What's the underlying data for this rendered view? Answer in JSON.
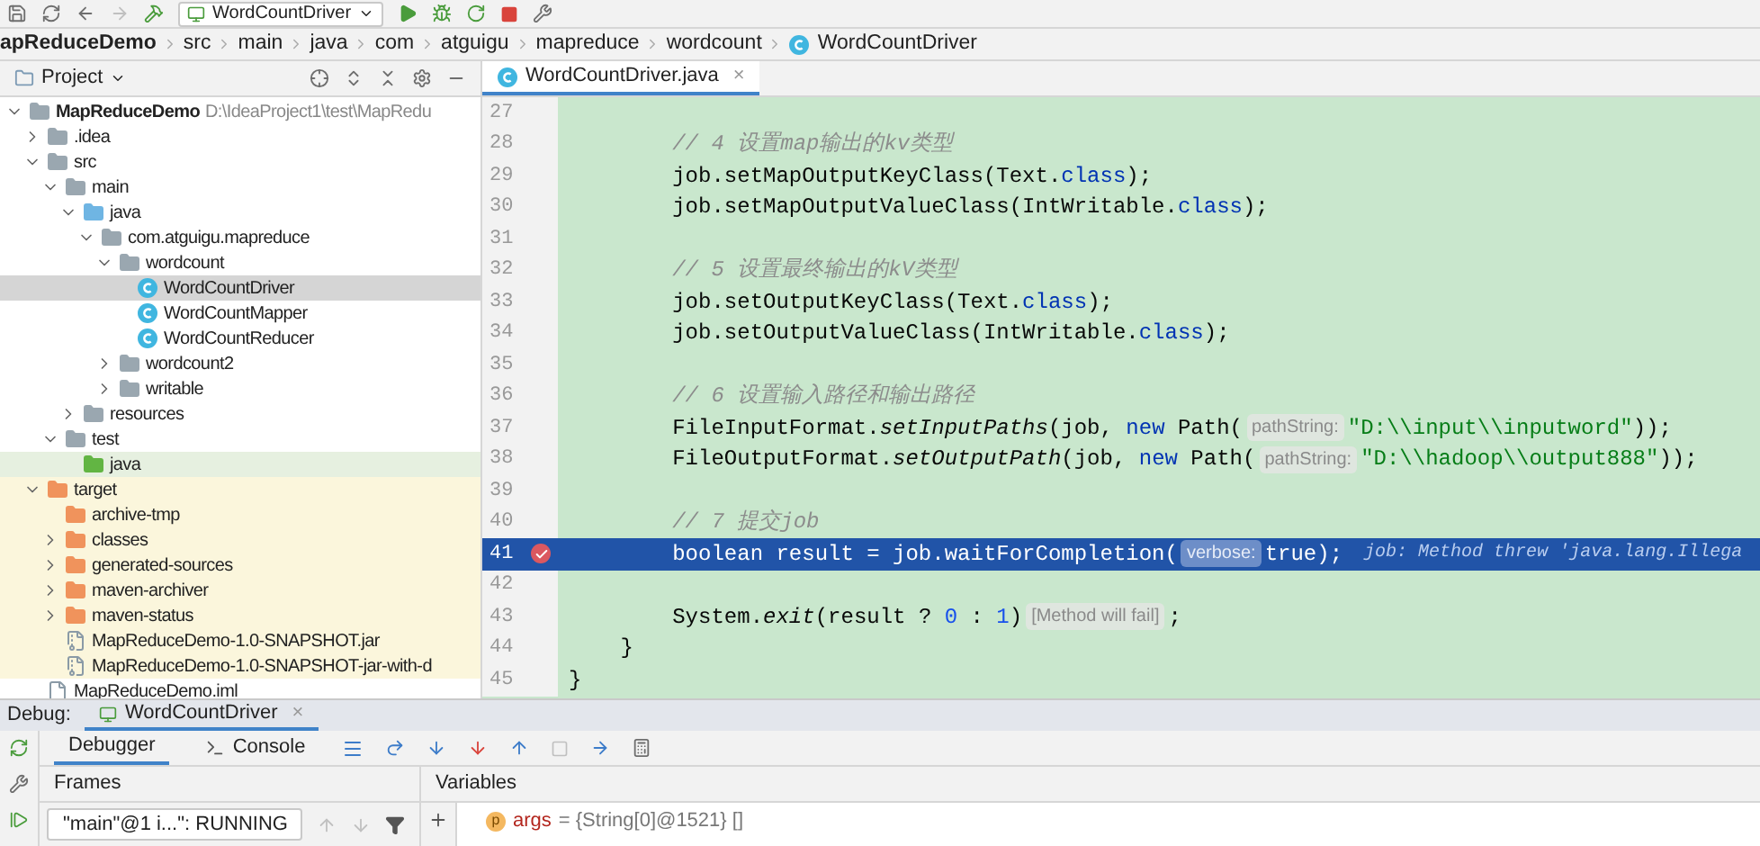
{
  "toolbar": {
    "run_config": "WordCountDriver"
  },
  "breadcrumbs": [
    {
      "label": "apReduceDemo",
      "kind": "module"
    },
    {
      "label": "src",
      "kind": "folder"
    },
    {
      "label": "main",
      "kind": "folder"
    },
    {
      "label": "java",
      "kind": "folder"
    },
    {
      "label": "com",
      "kind": "folder"
    },
    {
      "label": "atguigu",
      "kind": "folder"
    },
    {
      "label": "mapreduce",
      "kind": "folder"
    },
    {
      "label": "wordcount",
      "kind": "folder"
    },
    {
      "label": "WordCountDriver",
      "kind": "class"
    }
  ],
  "project": {
    "title": "Project",
    "tree": [
      {
        "label": "MapReduceDemo",
        "hint": "D:\\IdeaProject1\\test\\MapRedu",
        "kind": "module",
        "expanded": true,
        "selected": false,
        "children": [
          {
            "label": ".idea",
            "kind": "folder",
            "expanded": false,
            "selected": false
          },
          {
            "label": "src",
            "kind": "folder",
            "expanded": true,
            "selected": false,
            "children": [
              {
                "label": "main",
                "kind": "folder",
                "expanded": true,
                "selected": false,
                "children": [
                  {
                    "label": "java",
                    "kind": "source",
                    "expanded": true,
                    "selected": false,
                    "children": [
                      {
                        "label": "com.atguigu.mapreduce",
                        "kind": "package",
                        "expanded": true,
                        "selected": false,
                        "children": [
                          {
                            "label": "wordcount",
                            "kind": "package",
                            "expanded": true,
                            "selected": false,
                            "children": [
                              {
                                "label": "WordCountDriver",
                                "kind": "class",
                                "selected": true
                              },
                              {
                                "label": "WordCountMapper",
                                "kind": "class",
                                "selected": false
                              },
                              {
                                "label": "WordCountReducer",
                                "kind": "class",
                                "selected": false
                              }
                            ]
                          },
                          {
                            "label": "wordcount2",
                            "kind": "package",
                            "expanded": false,
                            "selected": false
                          },
                          {
                            "label": "writable",
                            "kind": "package",
                            "expanded": false,
                            "selected": false
                          }
                        ]
                      }
                    ]
                  },
                  {
                    "label": "resources",
                    "kind": "resources",
                    "expanded": false,
                    "selected": false
                  }
                ]
              },
              {
                "label": "test",
                "kind": "folder",
                "expanded": true,
                "selected": false,
                "children": [
                  {
                    "label": "java",
                    "kind": "test",
                    "selected": false
                  }
                ]
              }
            ]
          },
          {
            "label": "target",
            "kind": "excluded",
            "expanded": true,
            "selected": false,
            "children": [
              {
                "label": "archive-tmp",
                "kind": "excluded",
                "selected": false
              },
              {
                "label": "classes",
                "kind": "excluded",
                "expanded": false,
                "selected": false
              },
              {
                "label": "generated-sources",
                "kind": "excluded",
                "expanded": false,
                "selected": false
              },
              {
                "label": "maven-archiver",
                "kind": "excluded",
                "expanded": false,
                "selected": false
              },
              {
                "label": "maven-status",
                "kind": "excluded",
                "expanded": false,
                "selected": false
              },
              {
                "label": "MapReduceDemo-1.0-SNAPSHOT.jar",
                "kind": "jar",
                "selected": false
              },
              {
                "label": "MapReduceDemo-1.0-SNAPSHOT-jar-with-d",
                "kind": "jar",
                "selected": false
              }
            ]
          },
          {
            "label": "MapReduceDemo.iml",
            "kind": "file",
            "selected": false
          }
        ]
      }
    ]
  },
  "editor": {
    "tab": {
      "label": "WordCountDriver.java",
      "close": "×",
      "selected": true
    },
    "lines": [
      {
        "number": "27",
        "current": false,
        "breakpoint": false
      },
      {
        "number": "28",
        "current": false,
        "breakpoint": false,
        "tokens": [
          {
            "kind": "comment",
            "text": "        // 4 设置map输出的kv类型"
          }
        ]
      },
      {
        "number": "29",
        "current": false,
        "breakpoint": false,
        "tokens": [
          {
            "kind": "text",
            "text": "        job.setMapOutputKeyClass(Text."
          },
          {
            "kind": "keyword",
            "text": "class"
          },
          {
            "kind": "text",
            "text": ");"
          }
        ]
      },
      {
        "number": "30",
        "current": false,
        "breakpoint": false,
        "tokens": [
          {
            "kind": "text",
            "text": "        job.setMapOutputValueClass(IntWritable."
          },
          {
            "kind": "keyword",
            "text": "class"
          },
          {
            "kind": "text",
            "text": ");"
          }
        ]
      },
      {
        "number": "31",
        "current": false,
        "breakpoint": false
      },
      {
        "number": "32",
        "current": false,
        "breakpoint": false,
        "tokens": [
          {
            "kind": "comment",
            "text": "        // 5 设置最终输出的kV类型"
          }
        ]
      },
      {
        "number": "33",
        "current": false,
        "breakpoint": false,
        "tokens": [
          {
            "kind": "text",
            "text": "        job.setOutputKeyClass(Text."
          },
          {
            "kind": "keyword",
            "text": "class"
          },
          {
            "kind": "text",
            "text": ");"
          }
        ]
      },
      {
        "number": "34",
        "current": false,
        "breakpoint": false,
        "tokens": [
          {
            "kind": "text",
            "text": "        job.setOutputValueClass(IntWritable."
          },
          {
            "kind": "keyword",
            "text": "class"
          },
          {
            "kind": "text",
            "text": ");"
          }
        ]
      },
      {
        "number": "35",
        "current": false,
        "breakpoint": false
      },
      {
        "number": "36",
        "current": false,
        "breakpoint": false,
        "tokens": [
          {
            "kind": "comment",
            "text": "        // 6 设置输入路径和输出路径"
          }
        ]
      },
      {
        "number": "37",
        "current": false,
        "breakpoint": false,
        "tokens": [
          {
            "kind": "text",
            "text": "        FileInputFormat."
          },
          {
            "kind": "italic",
            "text": "setInputPaths"
          },
          {
            "kind": "text",
            "text": "(job, "
          },
          {
            "kind": "keyword",
            "text": "new"
          },
          {
            "kind": "text",
            "text": " Path("
          },
          {
            "kind": "hint",
            "text": "pathString:"
          },
          {
            "kind": "string",
            "text": "\"D:\\\\input\\\\inputword\""
          },
          {
            "kind": "text",
            "text": "));"
          }
        ]
      },
      {
        "number": "38",
        "current": false,
        "breakpoint": false,
        "tokens": [
          {
            "kind": "text",
            "text": "        FileOutputFormat."
          },
          {
            "kind": "italic",
            "text": "setOutputPath"
          },
          {
            "kind": "text",
            "text": "(job, "
          },
          {
            "kind": "keyword",
            "text": "new"
          },
          {
            "kind": "text",
            "text": " Path("
          },
          {
            "kind": "hint",
            "text": "pathString:"
          },
          {
            "kind": "string",
            "text": "\"D:\\\\hadoop\\\\output888\""
          },
          {
            "kind": "text",
            "text": "));"
          }
        ]
      },
      {
        "number": "39",
        "current": false,
        "breakpoint": false
      },
      {
        "number": "40",
        "current": false,
        "breakpoint": false,
        "tokens": [
          {
            "kind": "comment",
            "text": "        // 7 提交job"
          }
        ]
      },
      {
        "number": "41",
        "current": true,
        "breakpoint": true,
        "tokens": [
          {
            "kind": "text",
            "text": "        boolean result = job.waitForCompletion("
          },
          {
            "kind": "hint",
            "text": "verbose:"
          },
          {
            "kind": "text",
            "text": "true);"
          },
          {
            "kind": "error",
            "text": "job: Method threw 'java.lang.Illega"
          }
        ]
      },
      {
        "number": "42",
        "current": false,
        "breakpoint": false
      },
      {
        "number": "43",
        "current": false,
        "breakpoint": false,
        "tokens": [
          {
            "kind": "text",
            "text": "        System."
          },
          {
            "kind": "italic",
            "text": "exit"
          },
          {
            "kind": "text",
            "text": "(result ? "
          },
          {
            "kind": "number",
            "text": "0"
          },
          {
            "kind": "text",
            "text": " : "
          },
          {
            "kind": "number",
            "text": "1"
          },
          {
            "kind": "text",
            "text": ")"
          },
          {
            "kind": "hint",
            "text": "[Method will fail]"
          },
          {
            "kind": "text",
            "text": ";"
          }
        ]
      },
      {
        "number": "44",
        "current": false,
        "breakpoint": false,
        "tokens": [
          {
            "kind": "text",
            "text": "    }"
          }
        ]
      },
      {
        "number": "45",
        "current": false,
        "breakpoint": false,
        "tokens": [
          {
            "kind": "text",
            "text": "}"
          }
        ]
      }
    ]
  },
  "debug": {
    "label": "Debug:",
    "tab": {
      "label": "WordCountDriver",
      "close": "×"
    },
    "tabs": [
      {
        "label": "Debugger",
        "kind": "debugger",
        "selected": true
      },
      {
        "label": "Console",
        "kind": "console",
        "selected": false
      }
    ],
    "frames": {
      "title": "Frames",
      "thread": "\"main\"@1 i...\": RUNNING"
    },
    "variables": {
      "title": "Variables",
      "items": [
        {
          "badge": "p",
          "name": "args",
          "value": "= {String[0]@1521} []"
        }
      ]
    }
  }
}
